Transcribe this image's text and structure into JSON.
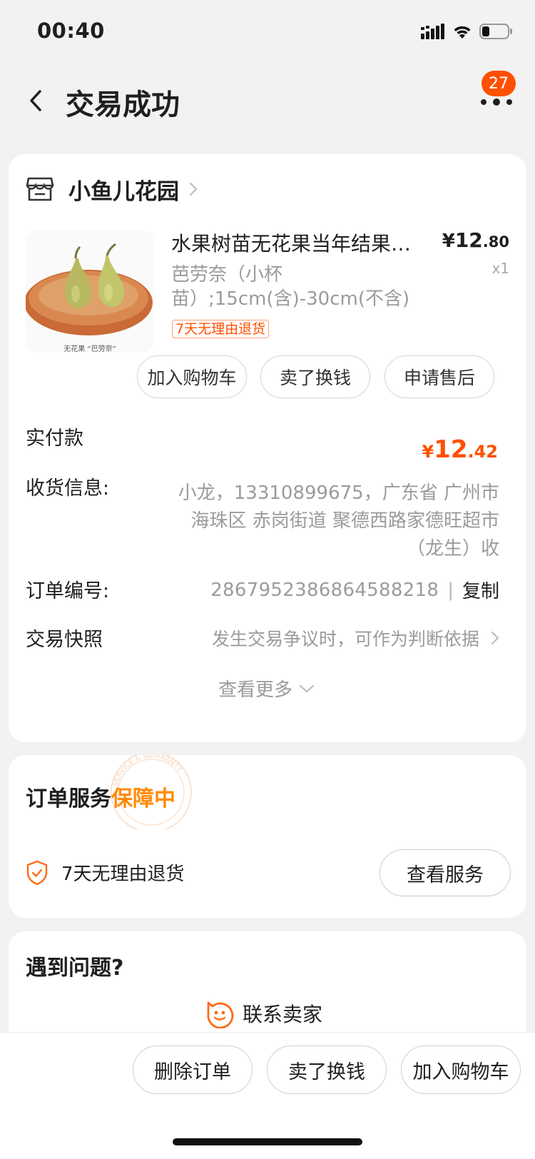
{
  "status": {
    "time": "00:40"
  },
  "nav": {
    "title": "交易成功",
    "badge": "27"
  },
  "shop": {
    "name": "小鱼儿花园"
  },
  "product": {
    "image_caption": "无花果 “巴劳奈”",
    "title": "水果树苗无花果当年结果盆栽南方北方种植庭院地栽",
    "price_symbol": "¥",
    "price_int": "12",
    "price_dec": ".80",
    "qty": "x1",
    "sku": "芭劳奈（小杯苗）;15cm(含)-30cm(不含)",
    "return_tag": "7天无理由退货"
  },
  "item_actions": [
    "加入购物车",
    "卖了换钱",
    "申请售后"
  ],
  "payment": {
    "label": "实付款",
    "symbol": "¥",
    "int": "12",
    "dec": ".42"
  },
  "shipping": {
    "label": "收货信息:",
    "value": "小龙，13310899675，广东省 广州市 海珠区 赤岗街道 聚德西路家德旺超市（龙生）收"
  },
  "order": {
    "label": "订单编号:",
    "number": "2867952386864588218",
    "separator": "|",
    "copy_label": "复制"
  },
  "snapshot": {
    "label": "交易快照",
    "hint": "发生交易争议时，可作为判断依据"
  },
  "view_more": "查看更多",
  "service": {
    "title": "订单服务",
    "status": "保障中",
    "item": "7天无理由退货",
    "button": "查看服务",
    "seal_text": "SERVICE & WARRANTY"
  },
  "help": {
    "title": "遇到问题?",
    "contact": "联系卖家"
  },
  "bottom_actions": [
    "删除订单",
    "卖了换钱",
    "加入购物车"
  ],
  "colors": {
    "accent": "#ff5000",
    "service_highlight": "#ff8a00",
    "muted_text": "#9b9b9b"
  }
}
